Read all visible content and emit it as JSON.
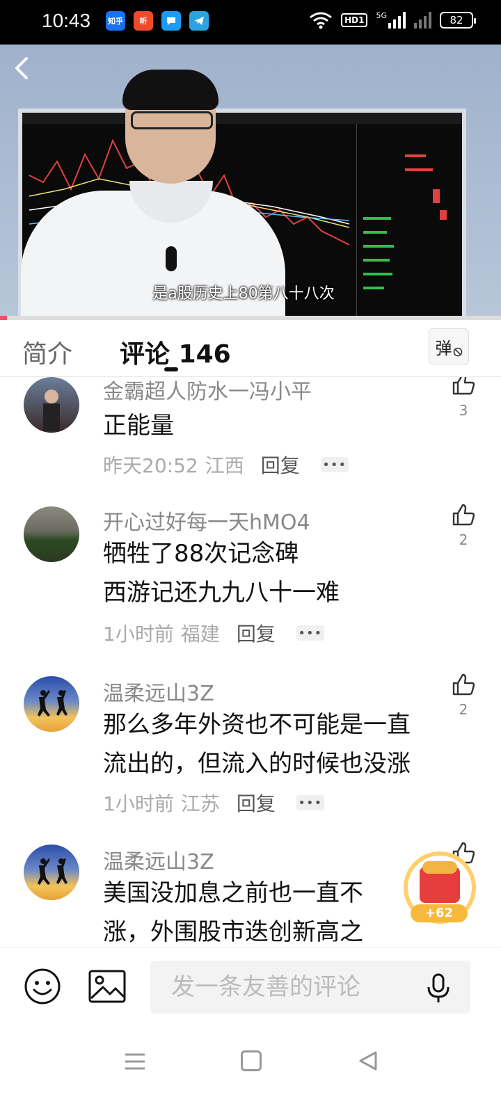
{
  "status_bar": {
    "time": "10:43",
    "apps": [
      {
        "name": "zhihu-app-icon",
        "label": "知乎",
        "color": "#1772f6"
      },
      {
        "name": "ting-app-icon",
        "label": "听",
        "color": "#f04a2a"
      },
      {
        "name": "message-app-icon",
        "label": "",
        "color": "#1b9cf2"
      },
      {
        "name": "telegram-app-icon",
        "label": "",
        "color": "#2aa3e0"
      }
    ],
    "hd_label": "HD1",
    "network": "5G",
    "battery": "82"
  },
  "video": {
    "subtitle": "是a股历史上80第八十八次"
  },
  "tabs": {
    "intro": "简介",
    "comments_label": "评论",
    "comments_count": "146",
    "danmu_label": "弹"
  },
  "comments": [
    {
      "user": "金霸超人防水一冯小平",
      "lines": [
        "正能量"
      ],
      "time": "昨天20:52",
      "location": "江西",
      "reply": "回复",
      "likes": "3"
    },
    {
      "user": "开心过好每一天hMO4",
      "lines": [
        "牺牲了88次记念碑",
        "西游记还九九八十一难"
      ],
      "time": "1小时前",
      "location": "福建",
      "reply": "回复",
      "likes": "2"
    },
    {
      "user": "温柔远山3Z",
      "lines": [
        "那么多年外资也不可能是一直",
        "流出的，但流入的时候也没涨"
      ],
      "time": "1小时前",
      "location": "江苏",
      "reply": "回复",
      "likes": "2"
    },
    {
      "user": "温柔远山3Z",
      "lines": [
        "美国没加息之前也一直不",
        "涨，外围股市迭创新高之"
      ],
      "time": "",
      "location": "",
      "reply": "",
      "likes": ""
    }
  ],
  "red_envelope": {
    "badge": "+62"
  },
  "input": {
    "placeholder": "发一条友善的评论"
  },
  "colors": {
    "accent": "#ff4d6d",
    "envelope_red": "#e83d3d",
    "envelope_gold": "#f6b93b"
  }
}
